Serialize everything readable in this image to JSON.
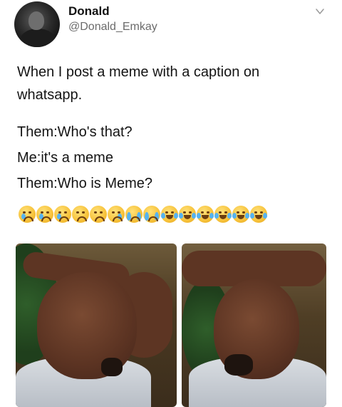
{
  "tweet": {
    "author_name": "Donald",
    "author_handle": "@Donald_Emkay",
    "text_lines": [
      "When I post a meme with a caption on",
      "whatsapp.",
      "Them:Who's that?",
      "Me:it's a meme",
      "Them:Who is Meme?"
    ],
    "emojis": [
      "crying-face",
      "crying-face",
      "crying-face",
      "weary-face",
      "weary-face",
      "crying-face",
      "loudly-crying-face",
      "loudly-crying-face",
      "face-with-tears-of-joy",
      "face-with-tears-of-joy",
      "face-with-tears-of-joy",
      "face-with-tears-of-joy",
      "face-with-tears-of-joy",
      "face-with-tears-of-joy"
    ],
    "images": [
      "meme-photo-man-holding-head-left",
      "meme-photo-man-holding-head-right"
    ]
  },
  "icons": {
    "menu": "chevron-down-icon",
    "avatar": "avatar"
  },
  "colors": {
    "text": "#141414",
    "secondary": "#6b6b6b",
    "background": "#ffffff"
  }
}
